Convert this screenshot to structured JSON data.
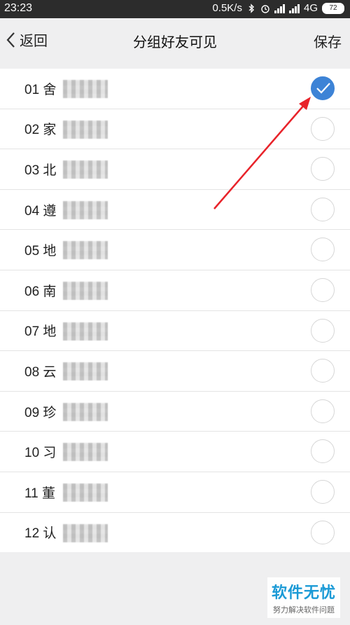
{
  "status_bar": {
    "time": "23:23",
    "speed": "0.5K/s",
    "network": "4G",
    "battery": "72"
  },
  "nav": {
    "back_label": "返回",
    "title": "分组好友可见",
    "save_label": "保存"
  },
  "groups": [
    {
      "label": "01 舍",
      "checked": true
    },
    {
      "label": "02 家",
      "checked": false
    },
    {
      "label": "03 北",
      "checked": false
    },
    {
      "label": "04 遵",
      "checked": false
    },
    {
      "label": "05 地",
      "checked": false
    },
    {
      "label": "06 南",
      "checked": false
    },
    {
      "label": "07 地",
      "checked": false
    },
    {
      "label": "08 云",
      "checked": false
    },
    {
      "label": "09 珍",
      "checked": false
    },
    {
      "label": "10 习",
      "checked": false
    },
    {
      "label": "11 董",
      "checked": false
    },
    {
      "label": "12 认",
      "checked": false
    }
  ],
  "colors": {
    "accent": "#3d83d6",
    "annotation_arrow": "#e8232a"
  },
  "watermark": {
    "main": "软件无忧",
    "sub": "努力解决软件问题"
  }
}
